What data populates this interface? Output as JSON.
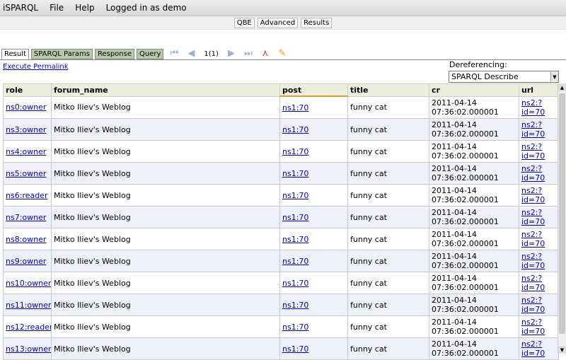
{
  "menu": {
    "app": "iSPARQL",
    "file": "File",
    "help": "Help",
    "login": "Logged in as demo"
  },
  "modes": [
    "QBE",
    "Advanced",
    "Results"
  ],
  "tabs": [
    "Result",
    "SPARQL Params",
    "Response",
    "Query"
  ],
  "pager": "1(1)",
  "permalink": "Execute Permalink",
  "deref": {
    "label": "Dereferencing:",
    "value": "SPARQL Describe"
  },
  "table": {
    "columns": [
      "role",
      "forum_name",
      "post",
      "title",
      "cr",
      "url"
    ],
    "rows": [
      {
        "role": "ns0:owner",
        "forum": "Mitko Iliev's Weblog",
        "post": "ns1:70",
        "title": "funny cat",
        "cr1": "2011-04-14",
        "cr2": "07:36:02.000001",
        "url1": "ns2:?",
        "url2": "id=70"
      },
      {
        "role": "ns3:owner",
        "forum": "Mitko Iliev's Weblog",
        "post": "ns1:70",
        "title": "funny cat",
        "cr1": "2011-04-14",
        "cr2": "07:36:02.000001",
        "url1": "ns2:?",
        "url2": "id=70"
      },
      {
        "role": "ns4:owner",
        "forum": "Mitko Iliev's Weblog",
        "post": "ns1:70",
        "title": "funny cat",
        "cr1": "2011-04-14",
        "cr2": "07:36:02.000001",
        "url1": "ns2:?",
        "url2": "id=70"
      },
      {
        "role": "ns5:owner",
        "forum": "Mitko Iliev's Weblog",
        "post": "ns1:70",
        "title": "funny cat",
        "cr1": "2011-04-14",
        "cr2": "07:36:02.000001",
        "url1": "ns2:?",
        "url2": "id=70"
      },
      {
        "role": "ns6:reader",
        "forum": "Mitko Iliev's Weblog",
        "post": "ns1:70",
        "title": "funny cat",
        "cr1": "2011-04-14",
        "cr2": "07:36:02.000001",
        "url1": "ns2:?",
        "url2": "id=70"
      },
      {
        "role": "ns7:owner",
        "forum": "Mitko Iliev's Weblog",
        "post": "ns1:70",
        "title": "funny cat",
        "cr1": "2011-04-14",
        "cr2": "07:36:02.000001",
        "url1": "ns2:?",
        "url2": "id=70"
      },
      {
        "role": "ns8:owner",
        "forum": "Mitko Iliev's Weblog",
        "post": "ns1:70",
        "title": "funny cat",
        "cr1": "2011-04-14",
        "cr2": "07:36:02.000001",
        "url1": "ns2:?",
        "url2": "id=70"
      },
      {
        "role": "ns9:owner",
        "forum": "Mitko Iliev's Weblog",
        "post": "ns1:70",
        "title": "funny cat",
        "cr1": "2011-04-14",
        "cr2": "07:36:02.000001",
        "url1": "ns2:?",
        "url2": "id=70"
      },
      {
        "role": "ns10:owner",
        "forum": "Mitko Iliev's Weblog",
        "post": "ns1:70",
        "title": "funny cat",
        "cr1": "2011-04-14",
        "cr2": "07:36:02.000001",
        "url1": "ns2:?",
        "url2": "id=70"
      },
      {
        "role": "ns11:owner",
        "forum": "Mitko Iliev's Weblog",
        "post": "ns1:70",
        "title": "funny cat",
        "cr1": "2011-04-14",
        "cr2": "07:36:02.000001",
        "url1": "ns2:?",
        "url2": "id=70"
      },
      {
        "role": "ns12:reader",
        "forum": "Mitko Iliev's Weblog",
        "post": "ns1:70",
        "title": "funny cat",
        "cr1": "2011-04-14",
        "cr2": "07:36:02.000001",
        "url1": "ns2:?",
        "url2": "id=70"
      },
      {
        "role": "ns13:owner",
        "forum": "Mitko Iliev's Weblog",
        "post": "ns1:70",
        "title": "funny cat",
        "cr1": "2011-04-14",
        "cr2": "07:36:02.000001",
        "url1": "ns2:?",
        "url2": "id=70"
      }
    ]
  }
}
